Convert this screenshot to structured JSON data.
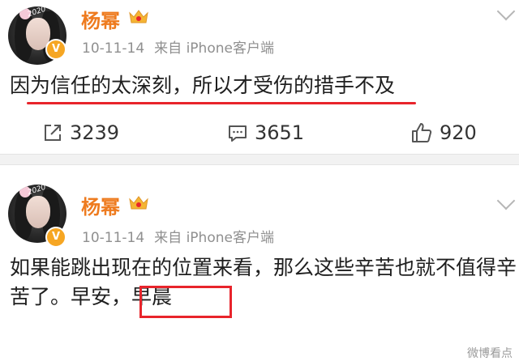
{
  "posts": [
    {
      "avatar_text": "2020",
      "user_name": "杨幂",
      "verified_badge": "V",
      "time": "10-11-14",
      "source": "来自 iPhone客户端",
      "content": "因为信任的太深刻，所以才受伤的措手不及",
      "repost_count": "3239",
      "comment_count": "3651",
      "like_count": "920"
    },
    {
      "avatar_text": "2020",
      "user_name": "杨幂",
      "verified_badge": "V",
      "time": "10-11-14",
      "source": "来自 iPhone客户端",
      "content_main": "如果能跳出现在的位置来看，那么这些辛苦也就不值得辛苦了。早安，",
      "content_highlight": "早晨"
    }
  ],
  "watermark": "微博看点",
  "colors": {
    "name": "#ee7b1f",
    "highlight": "#e8242b",
    "meta": "#8f8f8f",
    "badge": "#f6a623"
  },
  "icons": [
    "crown-icon",
    "repost-icon",
    "comment-icon",
    "like-icon",
    "chevron-down-icon",
    "verified-icon"
  ]
}
